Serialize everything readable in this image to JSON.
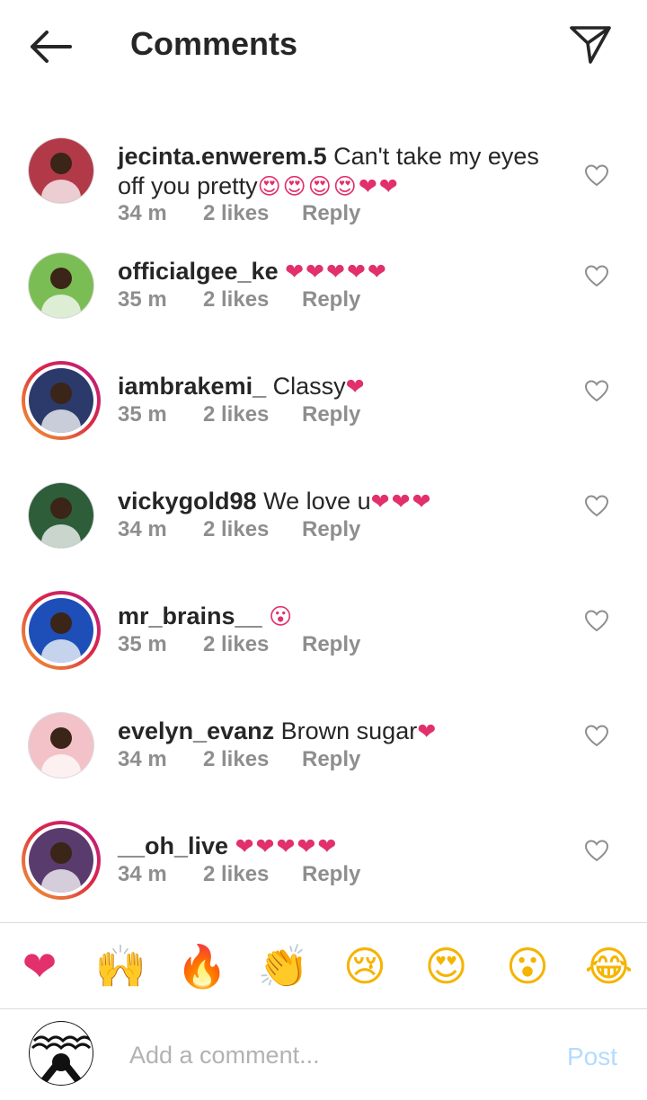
{
  "header": {
    "title": "Comments",
    "back_icon": "arrow-left-icon",
    "send_icon": "paper-plane-icon"
  },
  "comments": [
    {
      "username": "jecinta.enwerem.5",
      "text": " Can't take my eyes off you pretty",
      "emoji": "😍😍😍😍❤❤",
      "time": "34 m",
      "likes": "2 likes",
      "reply": "Reply",
      "ring": false,
      "avatar_color": "#b23a48"
    },
    {
      "username": "officialgee_ke",
      "text": " ",
      "emoji": "❤❤❤❤❤",
      "time": "35 m",
      "likes": "2 likes",
      "reply": "Reply",
      "ring": false,
      "avatar_color": "#7bbd55"
    },
    {
      "username": "iambrakemi_",
      "text": " Classy",
      "emoji": "❤",
      "time": "35 m",
      "likes": "2 likes",
      "reply": "Reply",
      "ring": true,
      "avatar_color": "#2b3a6b"
    },
    {
      "username": "vickygold98",
      "text": " We love u",
      "emoji": "❤❤❤",
      "time": "34 m",
      "likes": "2 likes",
      "reply": "Reply",
      "ring": false,
      "avatar_color": "#2e5d3a"
    },
    {
      "username": "mr_brains__",
      "text": " ",
      "emoji": "😮",
      "time": "35 m",
      "likes": "2 likes",
      "reply": "Reply",
      "ring": true,
      "avatar_color": "#1e4fb8"
    },
    {
      "username": "evelyn_evanz",
      "text": " Brown sugar",
      "emoji": "❤",
      "time": "34 m",
      "likes": "2 likes",
      "reply": "Reply",
      "ring": false,
      "avatar_color": "#f2c2c8"
    },
    {
      "username": "__oh_live",
      "text": " ",
      "emoji": "❤❤❤❤❤",
      "time": "34 m",
      "likes": "2 likes",
      "reply": "Reply",
      "ring": true,
      "avatar_color": "#5a3b6e"
    }
  ],
  "reactions": [
    {
      "glyph": "❤",
      "name": "heart",
      "color": "#e1306c",
      "more": false
    },
    {
      "glyph": "🙌",
      "name": "raised-hands",
      "color": "#f5b400",
      "more": true
    },
    {
      "glyph": "🔥",
      "name": "fire",
      "color": "#f26522",
      "more": false
    },
    {
      "glyph": "👏",
      "name": "clapping-hands",
      "color": "#f5b400",
      "more": true
    },
    {
      "glyph": "😢",
      "name": "crying-face",
      "color": "#f5b400",
      "more": false
    },
    {
      "glyph": "😍",
      "name": "heart-eyes",
      "color": "#f5b400",
      "more": false
    },
    {
      "glyph": "😮",
      "name": "surprised-face",
      "color": "#f5b400",
      "more": false
    },
    {
      "glyph": "😂",
      "name": "tears-of-joy",
      "color": "#f5b400",
      "more": false
    }
  ],
  "add_comment": {
    "placeholder": "Add a comment...",
    "post_label": "Post",
    "post_color": "#b3dbff"
  },
  "colors": {
    "heart_pink": "#e1306c",
    "meta_gray": "#8e8e8e",
    "text_dark": "#262626",
    "divider": "#dbdbdb"
  }
}
